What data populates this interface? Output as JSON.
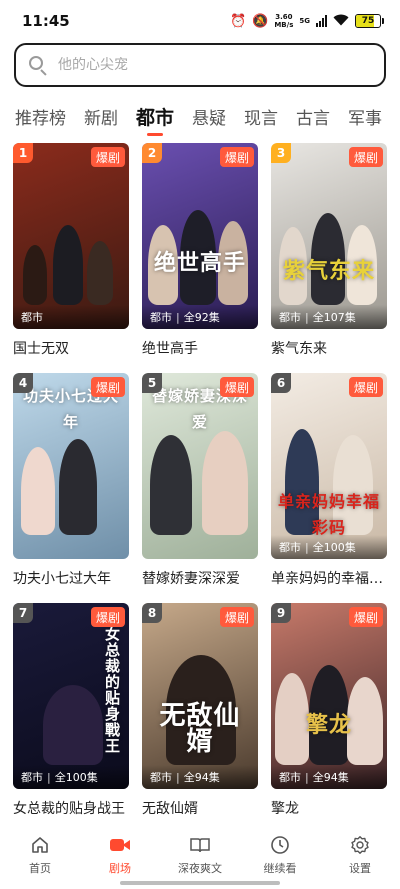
{
  "status": {
    "time": "11:45",
    "net_speed_value": "3.60",
    "net_speed_unit": "MB/s",
    "network": "5G",
    "battery": "75",
    "battery_level": 0.75
  },
  "search": {
    "placeholder": "他的心尖宠"
  },
  "tabs": [
    {
      "label": "推荐榜",
      "active": false
    },
    {
      "label": "新剧",
      "active": false
    },
    {
      "label": "都市",
      "active": true
    },
    {
      "label": "悬疑",
      "active": false
    },
    {
      "label": "现言",
      "active": false
    },
    {
      "label": "古言",
      "active": false
    },
    {
      "label": "军事",
      "active": false
    }
  ],
  "colors": {
    "accent": "#ff4a2f",
    "hot_badge": "#ff5a3c"
  },
  "hot_label": "爆剧",
  "cards": [
    {
      "rank": "1",
      "title": "国士无双",
      "genre": "都市",
      "episodes": "",
      "rank_color": "#ff5a2e",
      "bg": [
        "#8b2b1c",
        "#3b1a12"
      ],
      "poster_text": ""
    },
    {
      "rank": "2",
      "title": "绝世高手",
      "genre": "都市",
      "episodes": "全92集",
      "rank_color": "#ff8a30",
      "bg": [
        "#6a4fb0",
        "#2a1d52"
      ],
      "poster_text": "绝世高手"
    },
    {
      "rank": "3",
      "title": "紫气东来",
      "genre": "都市",
      "episodes": "全107集",
      "rank_color": "#ffb020",
      "bg": [
        "#e8e6e2",
        "#9c9890"
      ],
      "poster_text": "紫气东来"
    },
    {
      "rank": "4",
      "title": "功夫小七过大年",
      "genre": "",
      "episodes": "",
      "rank_color": "#555555",
      "bg": [
        "#bfd9ea",
        "#6f8fa8"
      ],
      "poster_text": "功夫小七过大年"
    },
    {
      "rank": "5",
      "title": "替嫁娇妻深深爱",
      "genre": "",
      "episodes": "",
      "rank_color": "#555555",
      "bg": [
        "#dfe8da",
        "#9fb09a"
      ],
      "poster_text": "替嫁娇妻深深爱"
    },
    {
      "rank": "6",
      "title": "单亲妈妈的幸福彩码",
      "genre": "都市",
      "episodes": "全100集",
      "rank_color": "#555555",
      "bg": [
        "#f3ece4",
        "#c9b8a5"
      ],
      "poster_text": "单亲妈妈幸福彩码"
    },
    {
      "rank": "7",
      "title": "女总裁的贴身战王",
      "genre": "都市",
      "episodes": "全100集",
      "rank_color": "#555555",
      "bg": [
        "#1a1a3a",
        "#0b0b1c"
      ],
      "poster_text": "女总裁的贴身戰王"
    },
    {
      "rank": "8",
      "title": "无敌仙婿",
      "genre": "都市",
      "episodes": "全94集",
      "rank_color": "#555555",
      "bg": [
        "#c6a98a",
        "#4a3a2d"
      ],
      "poster_text": "无敌仙婿"
    },
    {
      "rank": "9",
      "title": "擎龙",
      "genre": "都市",
      "episodes": "全94集",
      "rank_color": "#555555",
      "bg": [
        "#c77a6a",
        "#3a2326"
      ],
      "poster_text": "擎龙"
    }
  ],
  "nav": [
    {
      "label": "首页",
      "icon": "home-icon",
      "active": false
    },
    {
      "label": "剧场",
      "icon": "video-icon",
      "active": true
    },
    {
      "label": "深夜爽文",
      "icon": "book-icon",
      "active": false
    },
    {
      "label": "继续看",
      "icon": "clock-icon",
      "active": false
    },
    {
      "label": "设置",
      "icon": "gear-icon",
      "active": false
    }
  ]
}
